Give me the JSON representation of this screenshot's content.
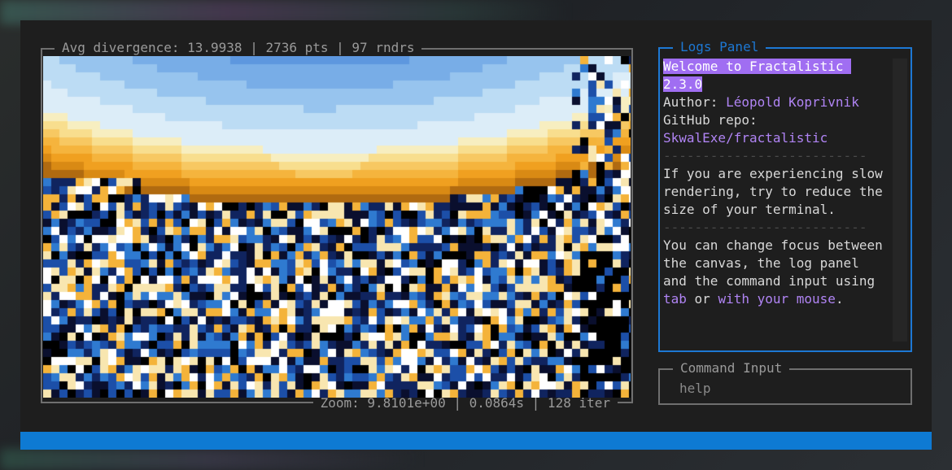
{
  "canvas": {
    "header": "Avg divergence: 13.9938 | 2736 pts | 97 rndrs",
    "footer": "Zoom: 9.8101e+00 | 0.0864s | 128 iter"
  },
  "logs_panel": {
    "title": "Logs Panel",
    "welcome_line1": "Welcome to Fractalistic ",
    "welcome_line2": "2.3.0",
    "author_label": "Author: ",
    "author_name": "Léopold Koprivnik",
    "repo_label": "GitHub repo:",
    "repo_value": "SkwalExe/fractalistic",
    "separator": "--------------------------",
    "tip1_line1": "If you are experiencing slow",
    "tip1_line2": "rendering, try to reduce the",
    "tip1_line3": "size of your terminal.",
    "tip2_line1": "You can change focus between",
    "tip2_line2": "the canvas, the log panel",
    "tip2_line3": "and the command input using",
    "tip2_tab": "tab",
    "tip2_or": " or ",
    "tip2_mouse": "with your mouse",
    "tip2_end": "."
  },
  "command_input": {
    "title": "Command Input",
    "placeholder": "help"
  },
  "colors": {
    "accent_blue": "#1d78d4",
    "accent_purple": "#b084f4",
    "statusbar": "#0e7ad3"
  }
}
